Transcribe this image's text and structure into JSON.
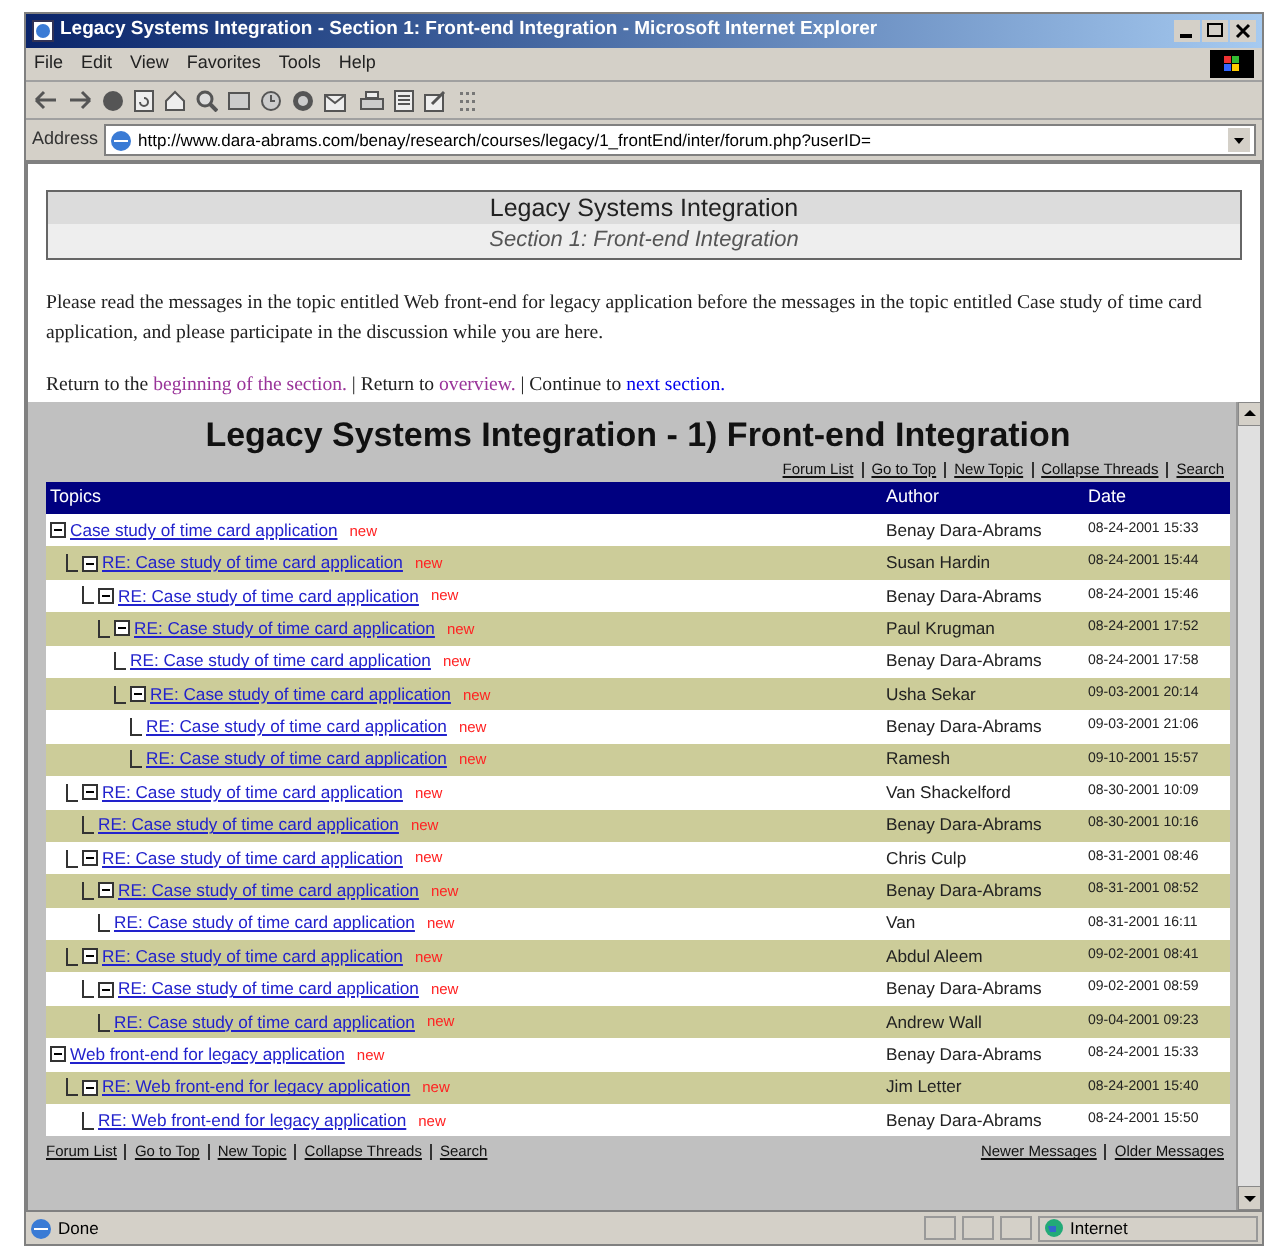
{
  "window": {
    "title": "Legacy Systems Integration - Section 1: Front-end Integration - Microsoft Internet Explorer"
  },
  "menu": [
    "File",
    "Edit",
    "View",
    "Favorites",
    "Tools",
    "Help"
  ],
  "address": {
    "label": "Address",
    "value": "http://www.dara-abrams.com/benay/research/courses/legacy/1_frontEnd/inter/forum.php?userID="
  },
  "page": {
    "header_title": "Legacy Systems Integration",
    "header_subtitle": "Section 1: Front-end Integration",
    "intro": "Please read the messages in the topic entitled Web front-end for legacy application before the messages in the topic entitled Case study of time card application, and please participate in the discussion while you are here.",
    "nav": [
      {
        "kind": "text",
        "text": "Return to the "
      },
      {
        "kind": "link",
        "text": "beginning of the section.",
        "visited": true
      },
      {
        "kind": "text",
        "text": " | Return to "
      },
      {
        "kind": "link",
        "text": "overview.",
        "visited": true
      },
      {
        "kind": "text",
        "text": " | Continue to "
      },
      {
        "kind": "link",
        "text": "next section.",
        "visited": false
      }
    ]
  },
  "forum": {
    "title": "Legacy Systems Integration - 1) Front-end Integration",
    "top_links": [
      "Forum List",
      "Go to Top",
      "New Topic",
      "Collapse Threads",
      "Search"
    ],
    "columns": [
      "Topics",
      "Author",
      "Date"
    ],
    "rows": [
      {
        "title": "Case study of time card application",
        "badge": "new",
        "author": "Benay Dara-Abrams",
        "date": "08-24-2001 15:33",
        "expanded": true,
        "children": [
          {
            "title": "RE: Case study of time card application",
            "badge": "new",
            "author": "Susan Hardin",
            "date": "08-24-2001 15:44",
            "expanded": true,
            "children": [
              {
                "title": "RE: Case study of time card application",
                "badge": "new",
                "author": "Benay Dara-Abrams",
                "date": "08-24-2001 15:46",
                "expanded": true,
                "children": [
                  {
                    "title": "RE: Case study of time card application",
                    "badge": "new",
                    "author": "Paul Krugman",
                    "date": "08-24-2001 17:52",
                    "expanded": true,
                    "children": [
                      {
                        "title": "RE: Case study of time card application",
                        "badge": "new",
                        "author": "Benay Dara-Abrams",
                        "date": "08-24-2001 17:58"
                      },
                      {
                        "title": "RE: Case study of time card application",
                        "badge": "new",
                        "author": "Usha Sekar",
                        "date": "09-03-2001 20:14",
                        "expanded": true,
                        "children": [
                          {
                            "title": "RE: Case study of time card application",
                            "badge": "new",
                            "author": "Benay Dara-Abrams",
                            "date": "09-03-2001 21:06"
                          },
                          {
                            "title": "RE: Case study of time card application",
                            "badge": "new",
                            "author": "Ramesh",
                            "date": "09-10-2001 15:57"
                          }
                        ]
                      }
                    ]
                  }
                ]
              }
            ]
          },
          {
            "title": "RE: Case study of time card application",
            "badge": "new",
            "author": "Van Shackelford",
            "date": "08-30-2001 10:09",
            "expanded": true,
            "children": [
              {
                "title": "RE: Case study of time card application",
                "badge": "new",
                "author": "Benay Dara-Abrams",
                "date": "08-30-2001 10:16"
              }
            ]
          },
          {
            "title": "RE: Case study of time card application",
            "badge": "new",
            "author": "Chris Culp",
            "date": "08-31-2001 08:46",
            "expanded": true,
            "children": [
              {
                "title": "RE: Case study of time card application",
                "badge": "new",
                "author": "Benay Dara-Abrams",
                "date": "08-31-2001 08:52",
                "expanded": true,
                "children": [
                  {
                    "title": "RE: Case study of time card application",
                    "badge": "new",
                    "author": "Van",
                    "date": "08-31-2001 16:11"
                  }
                ]
              }
            ]
          },
          {
            "title": "RE: Case study of time card application",
            "badge": "new",
            "author": "Abdul Aleem",
            "date": "09-02-2001 08:41",
            "expanded": true,
            "children": [
              {
                "title": "RE: Case study of time card application",
                "badge": "new",
                "author": "Benay Dara-Abrams",
                "date": "09-02-2001 08:59",
                "expanded": true,
                "children": [
                  {
                    "title": "RE: Case study of time card application",
                    "badge": "new",
                    "author": "Andrew Wall",
                    "date": "09-04-2001 09:23"
                  }
                ]
              }
            ]
          }
        ]
      },
      {
        "title": "Web front-end for legacy application",
        "badge": "new",
        "author": "Benay Dara-Abrams",
        "date": "08-24-2001 15:33",
        "expanded": true,
        "children": [
          {
            "title": "RE: Web front-end for legacy application",
            "badge": "new",
            "author": "Jim Letter",
            "date": "08-24-2001 15:40",
            "expanded": true,
            "children": [
              {
                "title": "RE: Web front-end for legacy application",
                "badge": "new",
                "author": "Benay Dara-Abrams",
                "date": "08-24-2001 15:50"
              }
            ]
          }
        ]
      }
    ],
    "bottom_links": [
      "Forum List",
      "Go to Top",
      "New Topic",
      "Collapse Threads",
      "Search"
    ],
    "bottom_right_links": [
      "Newer Messages",
      "Older Messages"
    ]
  },
  "status_bar": {
    "text": "Done",
    "zone": "Internet"
  }
}
